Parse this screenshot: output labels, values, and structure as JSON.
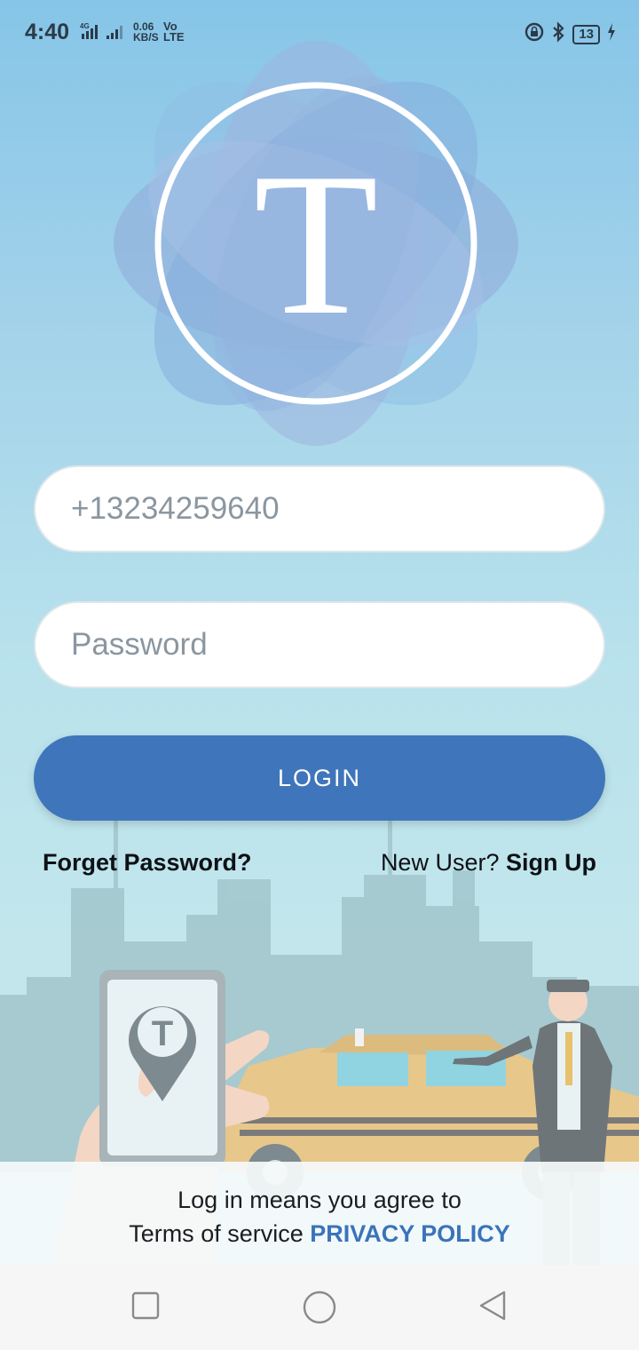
{
  "status_bar": {
    "time": "4:40",
    "network_speed_value": "0.06",
    "network_speed_unit": "KB/S",
    "volte_top": "Vo",
    "volte_bottom": "LTE",
    "battery_level": "13"
  },
  "logo": {
    "letter": "T"
  },
  "form": {
    "phone_value": "+13234259640",
    "password_placeholder": "Password",
    "login_label": "LOGIN",
    "forget_password_label": "Forget Password?",
    "new_user_text": "New User?",
    "sign_up_label": "Sign Up"
  },
  "illustration": {
    "pin_letter": "T"
  },
  "agreement": {
    "line1": "Log in means you agree to",
    "terms_text": "Terms of service",
    "privacy_label": "PRIVACY POLICY"
  },
  "colors": {
    "accent": "#3f76bb",
    "link": "#3b73b9",
    "bg_top": "#86c5e8",
    "bg_bottom": "#c6e6ea"
  },
  "icons": {
    "status": [
      "signal-icon",
      "lock-rotation-icon",
      "bluetooth-icon",
      "battery-icon",
      "charging-icon"
    ],
    "nav": [
      "recents-square-icon",
      "home-circle-icon",
      "back-triangle-icon"
    ]
  }
}
